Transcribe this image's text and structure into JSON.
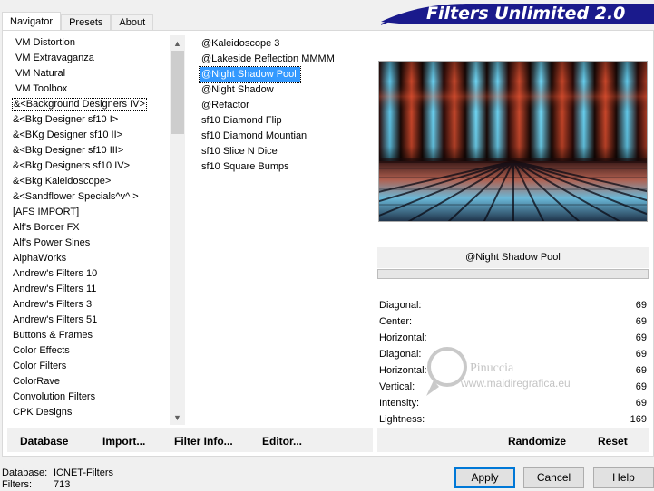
{
  "tabs": [
    "Navigator",
    "Presets",
    "About"
  ],
  "app_title": "Filters Unlimited 2.0",
  "categories": [
    "VM Distortion",
    "VM Extravaganza",
    "VM Natural",
    "VM Toolbox",
    "&<Background Designers IV>",
    "&<Bkg Designer sf10 I>",
    "&<BKg Designer sf10 II>",
    "&<Bkg Designer sf10 III>",
    "&<Bkg Designers sf10 IV>",
    "&<Bkg Kaleidoscope>",
    "&<Sandflower Specials^v^ >",
    "[AFS IMPORT]",
    "Alf's Border FX",
    "Alf's Power Sines",
    "AlphaWorks",
    "Andrew's Filters 10",
    "Andrew's Filters 11",
    "Andrew's Filters 3",
    "Andrew's Filters 51",
    "Buttons & Frames",
    "Color Effects",
    "Color Filters",
    "ColorRave",
    "Convolution Filters",
    "CPK Designs"
  ],
  "filters": [
    "@Kaleidoscope 3",
    "@Lakeside Reflection MMMM",
    "@Night Shadow Pool",
    "@Night Shadow",
    "@Refactor",
    "sf10 Diamond Flip",
    "sf10 Diamond Mountian",
    "sf10 Slice N Dice",
    "sf10 Square Bumps"
  ],
  "selected_filter_name": "@Night Shadow Pool",
  "params": [
    {
      "label": "Diagonal:",
      "value": "69"
    },
    {
      "label": "Center:",
      "value": "69"
    },
    {
      "label": "Horizontal:",
      "value": "69"
    },
    {
      "label": "Diagonal:",
      "value": "69"
    },
    {
      "label": "Horizontal:",
      "value": "69"
    },
    {
      "label": "Vertical:",
      "value": "69"
    },
    {
      "label": "Intensity:",
      "value": "69"
    },
    {
      "label": "Lightness:",
      "value": "169"
    }
  ],
  "watermark": {
    "line1": "Pinuccia",
    "line2": "www.maidiregrafica.eu"
  },
  "commands": {
    "database": "Database",
    "import": "Import...",
    "filter_info": "Filter Info...",
    "editor": "Editor...",
    "randomize": "Randomize",
    "reset": "Reset"
  },
  "status": {
    "database_label": "Database:",
    "database_value": "ICNET-Filters",
    "filters_label": "Filters:",
    "filters_value": "713"
  },
  "buttons": {
    "apply": "Apply",
    "cancel": "Cancel",
    "help": "Help"
  },
  "colors": {
    "banner": "#1a1a8c",
    "selection": "#3399ff"
  }
}
